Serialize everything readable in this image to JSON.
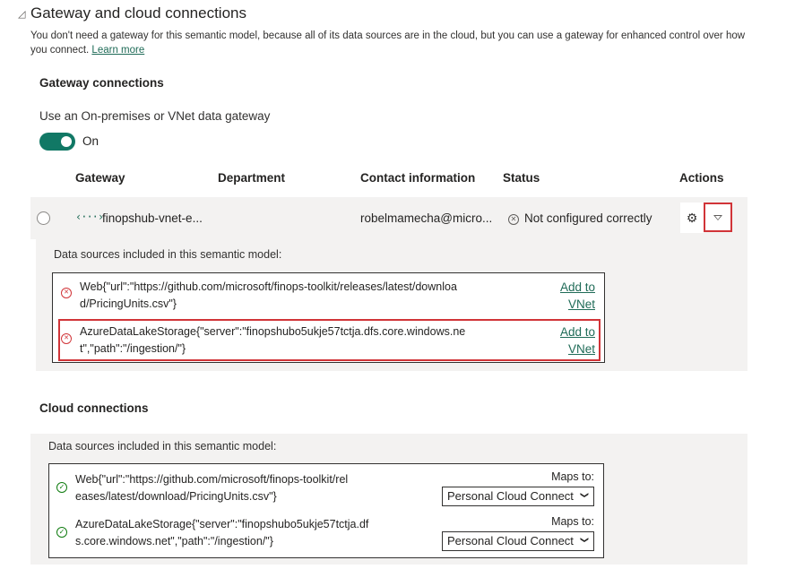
{
  "section": {
    "title": "Gateway and cloud connections",
    "description": "You don't need a gateway for this semantic model, because all of its data sources are in the cloud, but you can use a gateway for enhanced control over how you connect.",
    "learn_more": "Learn more"
  },
  "gateway": {
    "heading": "Gateway connections",
    "use_label": "Use an On-premises or VNet data gateway",
    "toggle_state": "On",
    "columns": {
      "gateway": "Gateway",
      "department": "Department",
      "contact": "Contact information",
      "status": "Status",
      "actions": "Actions"
    },
    "row": {
      "name": "finopshub-vnet-e...",
      "contact": "robelmamecha@micro...",
      "status": "Not configured correctly"
    },
    "sources_title": "Data sources included in this semantic model:",
    "sources": [
      {
        "line1": "Web{\"url\":\"https://github.com/microsoft/finops-toolkit/releases/latest/downloa",
        "line2": "d/PricingUnits.csv\"}",
        "action1": "Add to",
        "action2": "VNet"
      },
      {
        "line1": "AzureDataLakeStorage{\"server\":\"finopshubo5ukje57tctja.dfs.core.windows.ne",
        "line2": "t\",\"path\":\"/ingestion/\"}",
        "action1": "Add to",
        "action2": "VNet"
      }
    ]
  },
  "cloud": {
    "heading": "Cloud connections",
    "sources_title": "Data sources included in this semantic model:",
    "sources": [
      {
        "line1": "Web{\"url\":\"https://github.com/microsoft/finops-toolkit/rel",
        "line2": "eases/latest/download/PricingUnits.csv\"}",
        "maps_label": "Maps to:",
        "selected": "Personal Cloud Connect"
      },
      {
        "line1": "AzureDataLakeStorage{\"server\":\"finopshubo5ukje57tctja.df",
        "line2": "s.core.windows.net\",\"path\":\"/ingestion/\"}",
        "maps_label": "Maps to:",
        "selected": "Personal Cloud Connect"
      }
    ]
  },
  "colors": {
    "accent": "#117865",
    "error": "#d13438",
    "success": "#107c10",
    "panel": "#f3f2f1"
  }
}
